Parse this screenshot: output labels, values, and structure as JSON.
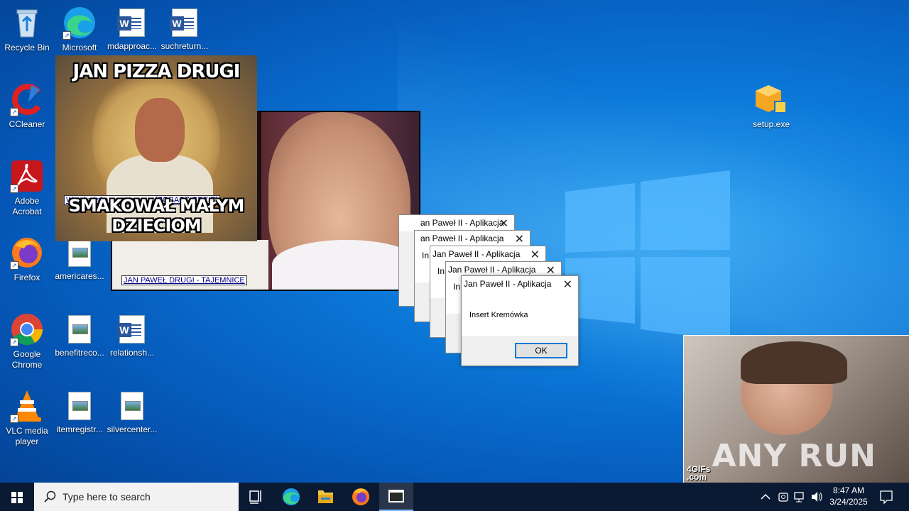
{
  "desktop": {
    "icons": [
      {
        "label": "Recycle Bin"
      },
      {
        "label": "Microsoft"
      },
      {
        "label": "mdapproac..."
      },
      {
        "label": "suchreturn..."
      },
      {
        "label": "CCleaner"
      },
      {
        "label": "Adobe Acrobat"
      },
      {
        "label": "Firefox"
      },
      {
        "label": "americares..."
      },
      {
        "label": "Google Chrome"
      },
      {
        "label": "benefitreco..."
      },
      {
        "label": "relationsh..."
      },
      {
        "label": "VLC media player"
      },
      {
        "label": "itemregistr..."
      },
      {
        "label": "silvercenter..."
      },
      {
        "label": "setup.exe"
      }
    ]
  },
  "popups": {
    "pizza": {
      "top_text": "JAN PIZZA DRUGI",
      "bottom_text": "SMAKOWAŁ MAŁYM DZIECIOM",
      "link": "Watykańska gastronomia [ZOBACZ GDZIE]"
    },
    "video": {
      "link": "JAN PAWEŁ DRUGI - TAJEMNICE"
    },
    "gif": {
      "corner": "4GIFs\n.com",
      "watermark": "ANY RUN"
    }
  },
  "dialogs": {
    "stack_title": "Jan Paweł II - Aplikacja",
    "stack_titles": [
      "an Paweł II - Aplikacja",
      "an Paweł II - Aplikacja",
      "Jan Paweł II - Aplikacja",
      "Jan Paweł II - Aplikacja"
    ],
    "stack_fragment": "In",
    "main": {
      "title": "Jan Paweł II - Aplikacja",
      "message": "Insert Kremówka",
      "ok": "OK"
    }
  },
  "taskbar": {
    "search_placeholder": "Type here to search",
    "time": "8:47 AM",
    "date": "3/24/2025"
  }
}
